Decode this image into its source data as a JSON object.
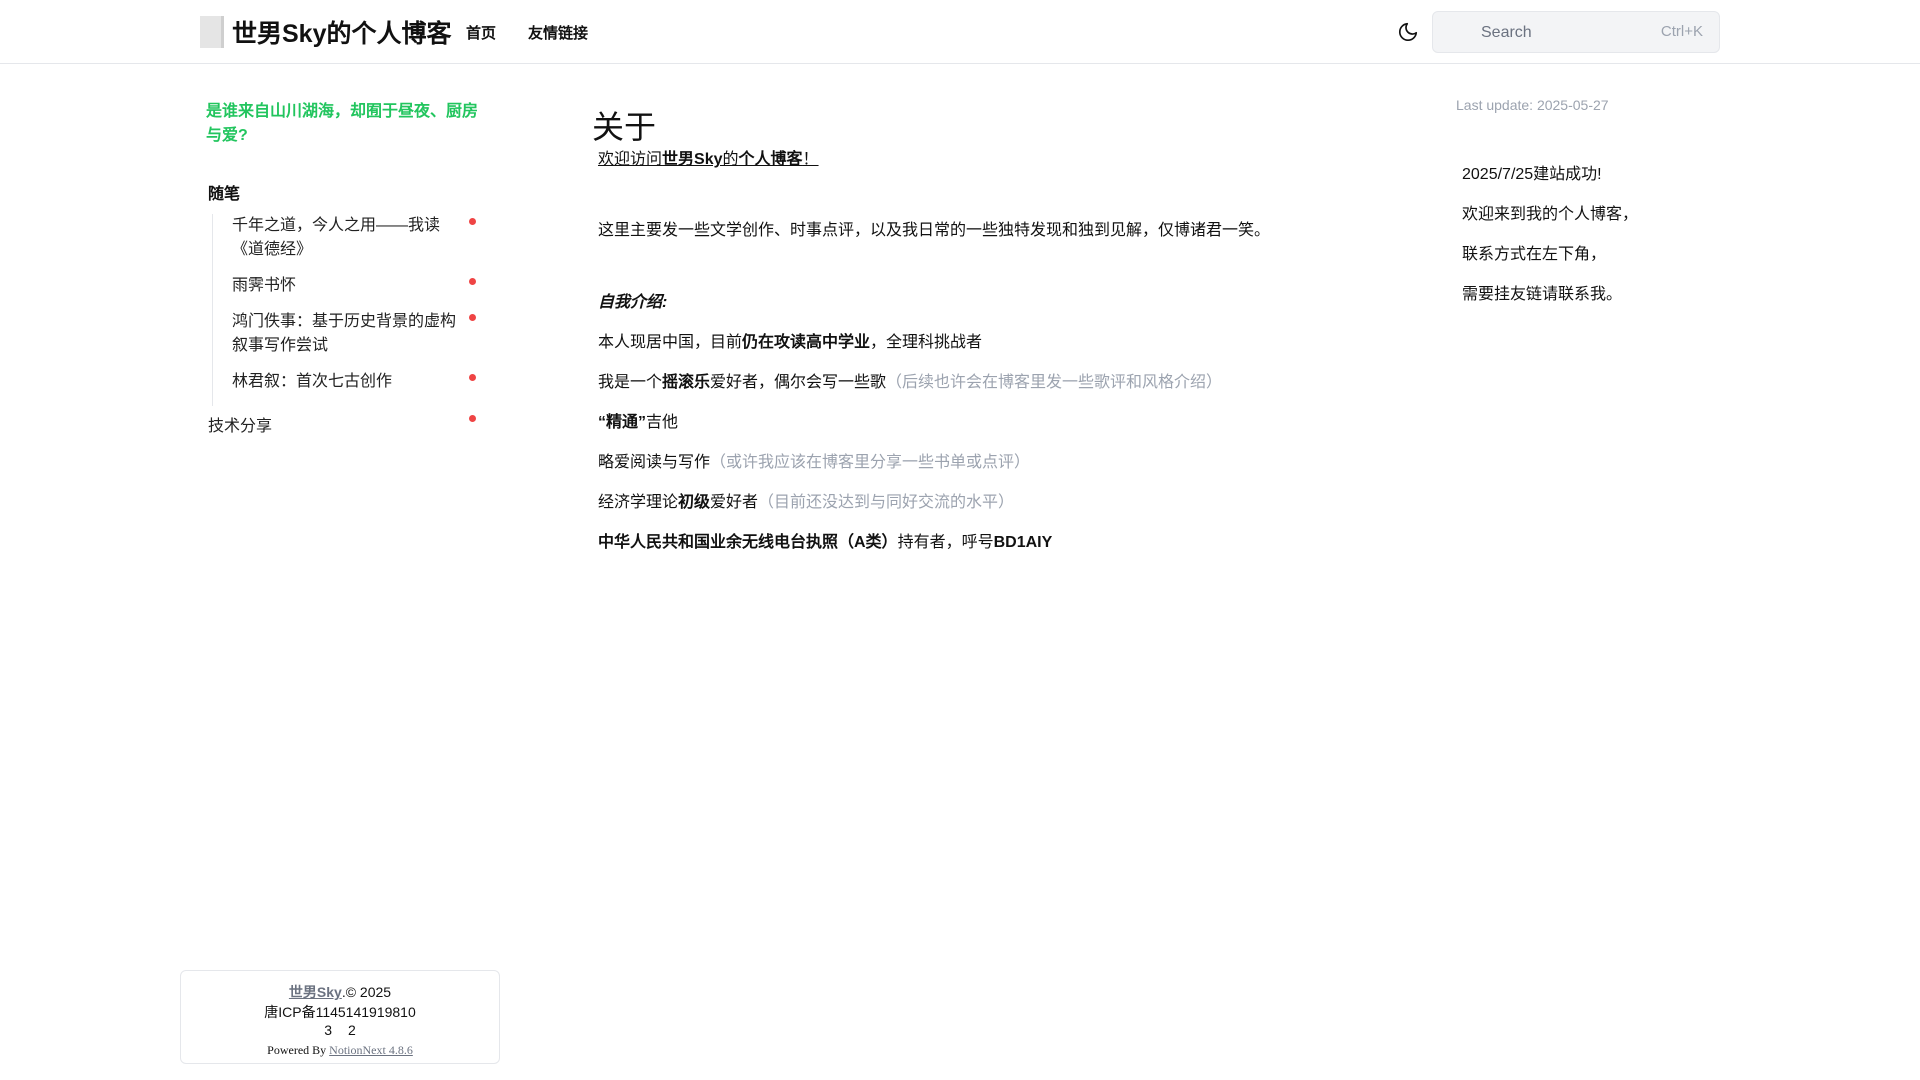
{
  "header": {
    "title": "世男Sky的个人博客",
    "nav": [
      {
        "label": "首页"
      },
      {
        "label": "友情链接"
      }
    ],
    "search": {
      "placeholder": "Search",
      "shortcut": "Ctrl+K"
    }
  },
  "sidebar": {
    "slogan": "是谁来自山川湖海，却囿于昼夜、厨房与爱?",
    "category": "随笔",
    "items": [
      {
        "label": "千年之道，今人之用——我读《道德经》"
      },
      {
        "label": "雨霁书怀"
      },
      {
        "label": "鸿门佚事：基于历史背景的虚构叙事写作尝试"
      },
      {
        "label": "林君叙：首次七古创作"
      }
    ],
    "category2": "技术分享"
  },
  "main": {
    "title": "关于",
    "welcome": {
      "prefix": "欢迎访问",
      "bold": "世男Sky",
      "mid": "的",
      "bold2": "个人博客",
      "suffix": "！"
    },
    "intro": "这里主要发一些文学创作、时事点评，以及我日常的一些独特发现和独到见解，仅博诸君一笑。",
    "self_intro_heading": "自我介绍:",
    "lines": {
      "l1": {
        "a": "本人现居中国，目前",
        "b": "仍在攻读高中学业",
        "c": "，全理科挑战者"
      },
      "l2": {
        "a": "我是一个",
        "b": "摇滚乐",
        "c": "爱好者，偶尔会写一些歌",
        "d": "（后续也许会在博客里发一些歌评和风格介绍）"
      },
      "l3": {
        "b": "“精通”",
        "c": "吉他"
      },
      "l4": {
        "a": "略爱阅读与写作",
        "d": "（或许我应该在博客里分享一些书单或点评）"
      },
      "l5": {
        "a": "经济学理论",
        "b": "初级",
        "c": "爱好者",
        "d": "（目前还没达到与同好交流的水平）"
      },
      "l6": {
        "b": "中华人民共和国业余无线电台执照（A类）",
        "c": "持有者，呼号",
        "d": "BD1AIY"
      }
    }
  },
  "aside": {
    "last_update": "Last update: 2025-05-27",
    "notices": [
      "2025/7/25建站成功!",
      "欢迎来到我的个人博客，",
      "联系方式在左下角，",
      "需要挂友链请联系我。"
    ]
  },
  "footer": {
    "author": "世男Sky",
    "copyright": ".© 2025",
    "icp": "唐ICP备1145141919810",
    "stat1": "3",
    "stat2": "2",
    "powered_prefix": "Powered By ",
    "powered_link": "NotionNext 4.8.6"
  },
  "colors": {
    "accent": "#22c55e",
    "dot": "#ef4444",
    "muted": "#9ca3af"
  }
}
